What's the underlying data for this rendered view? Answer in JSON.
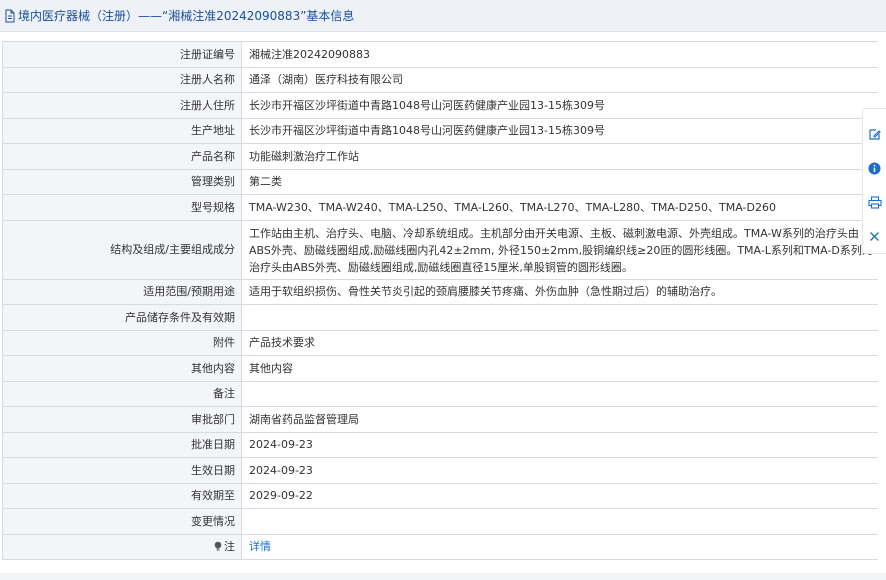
{
  "header": {
    "title": "境内医疗器械（注册）——“湘械注准20242090883”基本信息"
  },
  "rows": [
    {
      "label": "注册证编号",
      "value": "湘械注准20242090883"
    },
    {
      "label": "注册人名称",
      "value": "通泽（湖南）医疗科技有限公司"
    },
    {
      "label": "注册人住所",
      "value": "长沙市开福区沙坪街道中青路1048号山河医药健康产业园13-15栋309号"
    },
    {
      "label": "生产地址",
      "value": "长沙市开福区沙坪街道中青路1048号山河医药健康产业园13-15栋309号"
    },
    {
      "label": "产品名称",
      "value": "功能磁刺激治疗工作站"
    },
    {
      "label": "管理类别",
      "value": "第二类"
    },
    {
      "label": "型号规格",
      "value": "TMA-W230、TMA-W240、TMA-L250、TMA-L260、TMA-L270、TMA-L280、TMA-D250、TMA-D260"
    },
    {
      "label": "结构及组成/主要组成成分",
      "value": "工作站由主机、治疗头、电脑、冷却系统组成。主机部分由开关电源、主板、磁刺激电源、外壳组成。TMA-W系列的治疗头由ABS外壳、励磁线圈组成,励磁线圈内孔42±2mm, 外径150±2mm,股铜编织线≥20匝的圆形线圈。TMA-L系列和TMA-D系列的治疗头由ABS外壳、励磁线圈组成,励磁线圈直径15厘米,单股铜管的圆形线圈。"
    },
    {
      "label": "适用范围/预期用途",
      "value": "适用于软组织损伤、骨性关节炎引起的颈肩腰膝关节疼痛、外伤血肿（急性期过后）的辅助治疗。"
    },
    {
      "label": "产品储存条件及有效期",
      "value": ""
    },
    {
      "label": "附件",
      "value": "产品技术要求"
    },
    {
      "label": "其他内容",
      "value": "其他内容"
    },
    {
      "label": "备注",
      "value": ""
    },
    {
      "label": "审批部门",
      "value": "湖南省药品监督管理局"
    },
    {
      "label": "批准日期",
      "value": "2024-09-23"
    },
    {
      "label": "生效日期",
      "value": "2024-09-23"
    },
    {
      "label": "有效期至",
      "value": "2029-09-22"
    },
    {
      "label": "变更情况",
      "value": ""
    },
    {
      "label": "注",
      "value": "详情"
    }
  ],
  "sidebar": {
    "icons": [
      "edit-icon",
      "info-icon",
      "print-icon",
      "close-icon"
    ]
  },
  "colors": {
    "header_text": "#1a4fa0",
    "link": "#1a6fd0",
    "label_bg": "#f3f5f8",
    "border": "#d6dbe3"
  }
}
